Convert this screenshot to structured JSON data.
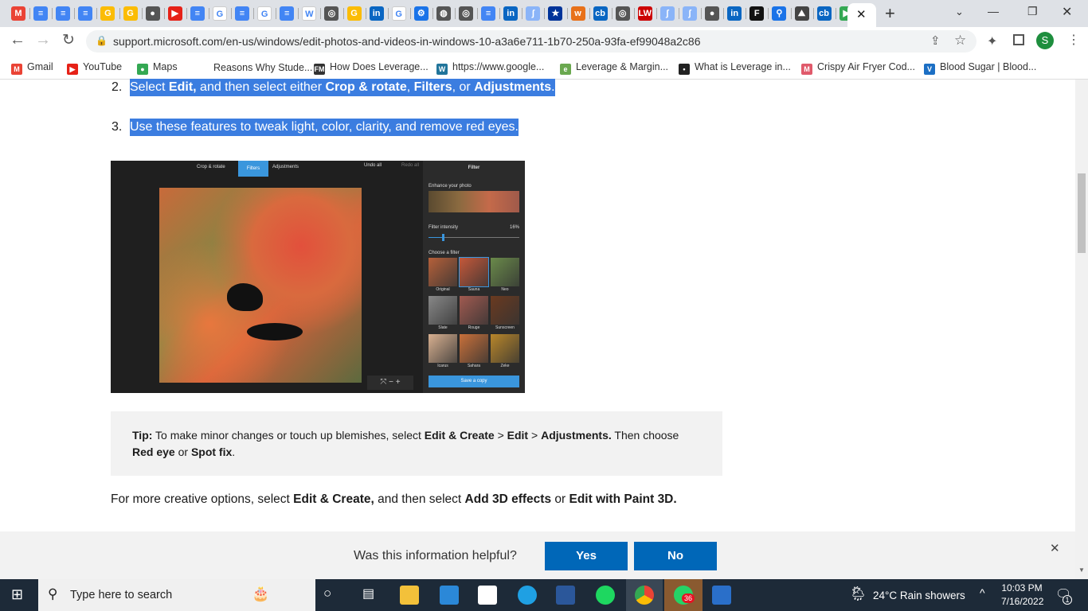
{
  "browser": {
    "tab_icons": [
      {
        "name": "gmail-icon",
        "color": "#ea4335",
        "glyph": "M"
      },
      {
        "name": "docs-icon",
        "color": "#4285f4",
        "glyph": "≡"
      },
      {
        "name": "docs-icon",
        "color": "#4285f4",
        "glyph": "≡"
      },
      {
        "name": "docs-icon",
        "color": "#4285f4",
        "glyph": "≡"
      },
      {
        "name": "google-icon",
        "color": "#fbbc05",
        "glyph": "G"
      },
      {
        "name": "google-icon",
        "color": "#fbbc05",
        "glyph": "G"
      },
      {
        "name": "globe-icon",
        "color": "#555",
        "glyph": "●"
      },
      {
        "name": "youtube-icon",
        "color": "#e62117",
        "glyph": "▶"
      },
      {
        "name": "docs-icon",
        "color": "#4285f4",
        "glyph": "≡"
      },
      {
        "name": "google-icon",
        "color": "#fff",
        "glyph": "G"
      },
      {
        "name": "docs-icon",
        "color": "#4285f4",
        "glyph": "≡"
      },
      {
        "name": "google-icon",
        "color": "#fff",
        "glyph": "G"
      },
      {
        "name": "docs-icon",
        "color": "#4285f4",
        "glyph": "≡"
      },
      {
        "name": "wikipedia-icon",
        "color": "#fff",
        "glyph": "W"
      },
      {
        "name": "chrome-icon",
        "color": "#555",
        "glyph": "◎"
      },
      {
        "name": "google-icon",
        "color": "#fbbc05",
        "glyph": "G"
      },
      {
        "name": "linkedin-icon",
        "color": "#0a66c2",
        "glyph": "in"
      },
      {
        "name": "google-icon",
        "color": "#fff",
        "glyph": "G"
      },
      {
        "name": "settings-icon",
        "color": "#1a73e8",
        "glyph": "⚙"
      },
      {
        "name": "globe-icon",
        "color": "#555",
        "glyph": "◍"
      },
      {
        "name": "chrome-icon",
        "color": "#555",
        "glyph": "◎"
      },
      {
        "name": "docs-icon",
        "color": "#4285f4",
        "glyph": "≡"
      },
      {
        "name": "linkedin-icon",
        "color": "#0a66c2",
        "glyph": "in"
      },
      {
        "name": "site-icon",
        "color": "#8ab4f8",
        "glyph": "ʃ"
      },
      {
        "name": "eu-icon",
        "color": "#003399",
        "glyph": "★"
      },
      {
        "name": "site-icon",
        "color": "#e8711a",
        "glyph": "w"
      },
      {
        "name": "cb-icon",
        "color": "#0a66c2",
        "glyph": "cb"
      },
      {
        "name": "chrome-icon",
        "color": "#555",
        "glyph": "◎"
      },
      {
        "name": "lw-icon",
        "color": "#c00",
        "glyph": "LW"
      },
      {
        "name": "site-icon",
        "color": "#8ab4f8",
        "glyph": "ʃ"
      },
      {
        "name": "site-icon",
        "color": "#8ab4f8",
        "glyph": "ʃ"
      },
      {
        "name": "globe-icon",
        "color": "#555",
        "glyph": "●"
      },
      {
        "name": "linkedin-icon",
        "color": "#0a66c2",
        "glyph": "in"
      },
      {
        "name": "forbes-icon",
        "color": "#111",
        "glyph": "F"
      },
      {
        "name": "search-icon",
        "color": "#1a73e8",
        "glyph": "⚲"
      },
      {
        "name": "site-icon",
        "color": "#444",
        "glyph": "⛰"
      },
      {
        "name": "cb-icon",
        "color": "#0a66c2",
        "glyph": "cb"
      },
      {
        "name": "play-icon",
        "color": "#34a853",
        "glyph": "▶"
      }
    ],
    "url": "support.microsoft.com/en-us/windows/edit-photos-and-videos-in-windows-10-a3a6e711-1b70-250a-93fa-ef99048a2c86",
    "profile_initial": "S",
    "bookmarks": [
      {
        "label": "Gmail",
        "color": "#ea4335",
        "glyph": "M"
      },
      {
        "label": "YouTube",
        "color": "#e62117",
        "glyph": "▶"
      },
      {
        "label": "Maps",
        "color": "#34a853",
        "glyph": "●"
      },
      {
        "label": "Reasons Why Stude...",
        "color": "#fff",
        "glyph": ""
      },
      {
        "label": "How Does Leverage...",
        "color": "#333",
        "glyph": "FM"
      },
      {
        "label": "https://www.google...",
        "color": "#21759b",
        "glyph": "W"
      },
      {
        "label": "Leverage & Margin...",
        "color": "#6aa84f",
        "glyph": "e"
      },
      {
        "label": "What is Leverage in...",
        "color": "#222",
        "glyph": "•"
      },
      {
        "label": "Crispy Air Fryer Cod...",
        "color": "#e05a6b",
        "glyph": "M"
      },
      {
        "label": "Blood Sugar | Blood...",
        "color": "#1c6fc4",
        "glyph": "V"
      }
    ]
  },
  "article": {
    "steps": [
      {
        "num": "2.",
        "parts": [
          [
            "Select ",
            0
          ],
          [
            "Edit,",
            1
          ],
          [
            " and then select either ",
            0
          ],
          [
            "Crop & rotate",
            1
          ],
          [
            ", ",
            0
          ],
          [
            "Filters",
            1
          ],
          [
            ", or ",
            0
          ],
          [
            "Adjustments",
            1
          ],
          [
            ".",
            0
          ]
        ]
      },
      {
        "num": "3.",
        "parts": [
          [
            "Use these features to tweak light, color, clarity, and remove red eyes.",
            0
          ]
        ]
      }
    ],
    "screenshot": {
      "toolbar": {
        "crop": "Crop & rotate",
        "filters": "Filters",
        "adjustments": "Adjustments",
        "undo": "Undo all",
        "redo": "Redo all"
      },
      "panel_title": "Filter",
      "enhance_label": "Enhance your photo",
      "intensity_label": "Filter intensity",
      "intensity_value": "16%",
      "intensity": 0.16,
      "choose_label": "Choose a filter",
      "filters": [
        "Original",
        "Sauna",
        "Neo",
        "Slate",
        "Rouge",
        "Sunscreen",
        "Icarus",
        "Sahara",
        "Zeke"
      ],
      "selected_filter": "Sauna",
      "save_label": "Save a copy"
    },
    "tip": {
      "label": "Tip:",
      "parts": [
        [
          " To make minor changes or touch up blemishes, select ",
          0
        ],
        [
          "Edit & Create",
          1
        ],
        [
          " > ",
          0
        ],
        [
          "Edit",
          1
        ],
        [
          " > ",
          0
        ],
        [
          "Adjustments.",
          1
        ],
        [
          " Then choose ",
          0
        ],
        [
          "Red eye",
          1
        ],
        [
          " or ",
          0
        ],
        [
          "Spot fix",
          1
        ],
        [
          ".",
          0
        ]
      ]
    },
    "para": [
      [
        "For more creative options, select ",
        0
      ],
      [
        "Edit & Create,",
        1
      ],
      [
        " and then select ",
        0
      ],
      [
        "Add 3D effects",
        1
      ],
      [
        " or ",
        0
      ],
      [
        "Edit with Paint 3D.",
        1
      ]
    ]
  },
  "feedback": {
    "question": "Was this information helpful?",
    "yes": "Yes",
    "no": "No"
  },
  "taskbar": {
    "search_placeholder": "Type here to search",
    "weather": "24°C  Rain showers",
    "time": "10:03 PM",
    "date": "7/16/2022",
    "whatsapp_badge": "36",
    "notification_count": "1"
  }
}
